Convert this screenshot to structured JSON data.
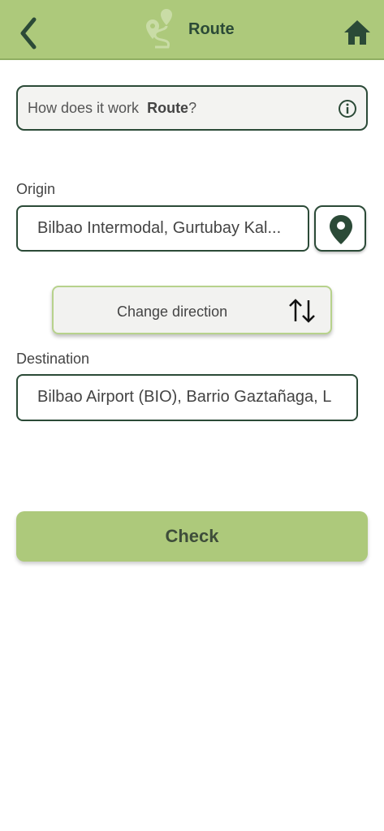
{
  "header": {
    "title": "Route",
    "back_icon": "chevron-left-icon",
    "logo_icon": "route-pin-icon",
    "home_icon": "home-icon",
    "bg_color": "#adc97b"
  },
  "info": {
    "prefix": "How does it work",
    "bold": "Route",
    "suffix": "?",
    "icon": "info-icon"
  },
  "origin": {
    "label": "Origin",
    "value": "Bilbao Intermodal, Gurtubay Kal...",
    "pin_icon": "map-pin-icon"
  },
  "change_direction": {
    "label": "Change direction",
    "icon": "swap-arrows-icon"
  },
  "destination": {
    "label": "Destination",
    "value": "Bilbao Airport (BIO), Barrio Gaztañaga, L"
  },
  "check": {
    "label": "Check"
  },
  "colors": {
    "accent": "#adc97b",
    "dark_green": "#2b4a37"
  }
}
